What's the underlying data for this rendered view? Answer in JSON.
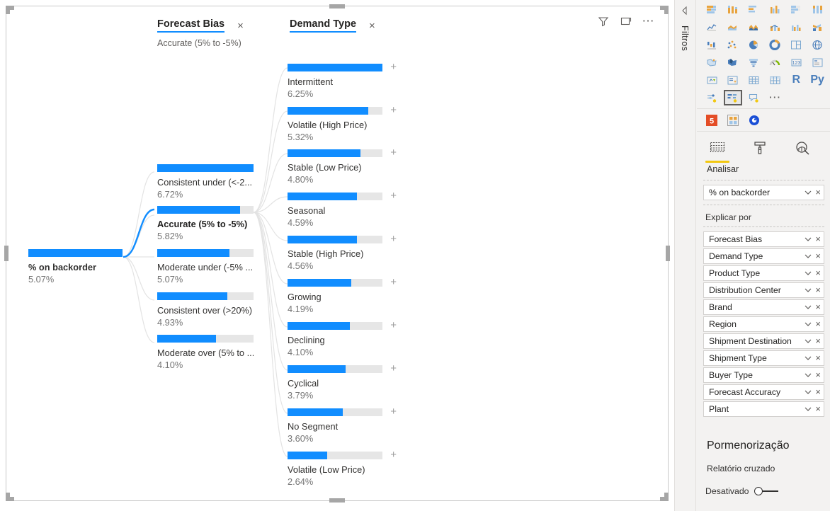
{
  "visual": {
    "header_icons": [
      "filter-icon",
      "focus-mode-icon",
      "more-options-icon"
    ],
    "columns": [
      {
        "title": "Forecast Bias",
        "subtitle": "Accurate (5% to -5%)",
        "close": "×"
      },
      {
        "title": "Demand Type",
        "subtitle": "",
        "close": "×"
      }
    ],
    "root": {
      "label": "% on backorder",
      "value": "5.07%",
      "fill_pct": 100
    },
    "level1": [
      {
        "label": "Consistent under (<-2...",
        "value": "6.72%",
        "fill_pct": 100,
        "selected": false
      },
      {
        "label": "Accurate (5% to -5%)",
        "value": "5.82%",
        "fill_pct": 86,
        "selected": true
      },
      {
        "label": "Moderate under (-5% ...",
        "value": "5.07%",
        "fill_pct": 75,
        "selected": false
      },
      {
        "label": "Consistent over (>20%)",
        "value": "4.93%",
        "fill_pct": 73,
        "selected": false
      },
      {
        "label": "Moderate over (5% to ...",
        "value": "4.10%",
        "fill_pct": 61,
        "selected": false
      }
    ],
    "level2": [
      {
        "label": "Intermittent",
        "value": "6.25%",
        "fill_pct": 100,
        "expand": "+"
      },
      {
        "label": "Volatile (High Price)",
        "value": "5.32%",
        "fill_pct": 85,
        "expand": "+"
      },
      {
        "label": "Stable (Low Price)",
        "value": "4.80%",
        "fill_pct": 77,
        "expand": "+"
      },
      {
        "label": "Seasonal",
        "value": "4.59%",
        "fill_pct": 73,
        "expand": "+"
      },
      {
        "label": "Stable (High Price)",
        "value": "4.56%",
        "fill_pct": 73,
        "expand": "+"
      },
      {
        "label": "Growing",
        "value": "4.19%",
        "fill_pct": 67,
        "expand": "+"
      },
      {
        "label": "Declining",
        "value": "4.10%",
        "fill_pct": 66,
        "expand": "+"
      },
      {
        "label": "Cyclical",
        "value": "3.79%",
        "fill_pct": 61,
        "expand": "+"
      },
      {
        "label": "No Segment",
        "value": "3.60%",
        "fill_pct": 58,
        "expand": "+"
      },
      {
        "label": "Volatile (Low Price)",
        "value": "2.64%",
        "fill_pct": 42,
        "expand": "+"
      }
    ]
  },
  "filters_rail": {
    "label": "Filtros",
    "expand_icon": "expand-pane-icon"
  },
  "viz_pane": {
    "gallery_icons": [
      "stacked-bar-chart-icon",
      "stacked-column-chart-icon",
      "clustered-bar-chart-icon",
      "clustered-column-chart-icon",
      "100-stacked-bar-chart-icon",
      "100-stacked-column-chart-icon",
      "line-chart-icon",
      "area-chart-icon",
      "stacked-area-chart-icon",
      "line-stacked-column-chart-icon",
      "line-clustered-column-chart-icon",
      "ribbon-chart-icon",
      "waterfall-chart-icon",
      "scatter-chart-icon",
      "pie-chart-icon",
      "donut-chart-icon",
      "treemap-icon",
      "map-icon",
      "filled-map-icon",
      "shape-map-icon",
      "funnel-chart-icon",
      "gauge-chart-icon",
      "card-icon",
      "multi-row-card-icon",
      "kpi-icon",
      "slicer-icon",
      "table-icon",
      "matrix-icon",
      "r-script-visual-icon",
      "python-visual-icon",
      "key-influencers-icon",
      "decomposition-tree-icon",
      "qa-visual-icon",
      "more-visuals-icon"
    ],
    "format_tabs": [
      "html-content-icon",
      "custom-visual-icon",
      "power-bi-visual-icon"
    ],
    "pane_tabs": [
      {
        "icon": "fields-pane-icon",
        "active": true
      },
      {
        "icon": "format-pane-icon",
        "active": false
      },
      {
        "icon": "analytics-pane-icon",
        "active": false
      }
    ],
    "pane_tab_label": "Analisar",
    "analyze_field": {
      "label": "% on backorder",
      "chevron": "chevron-down-icon",
      "remove": "×"
    },
    "explain_by_label": "Explicar por",
    "explain_by_fields": [
      "Forecast Bias",
      "Demand Type",
      "Product Type",
      "Distribution Center",
      "Brand",
      "Region",
      "Shipment Destination",
      "Shipment Type",
      "Buyer Type",
      "Forecast Accuracy",
      "Plant"
    ],
    "drill": {
      "title": "Pormenorização",
      "subtitle": "Relatório cruzado",
      "toggle_label": "Desativado",
      "toggle_on": false
    }
  },
  "colors": {
    "bar_fill": "#118DFF",
    "bar_track": "#e6e6e6",
    "accent_underline": "#118DFF",
    "pane_background": "#f3f2f1",
    "tab_underline": "#f2c811"
  }
}
